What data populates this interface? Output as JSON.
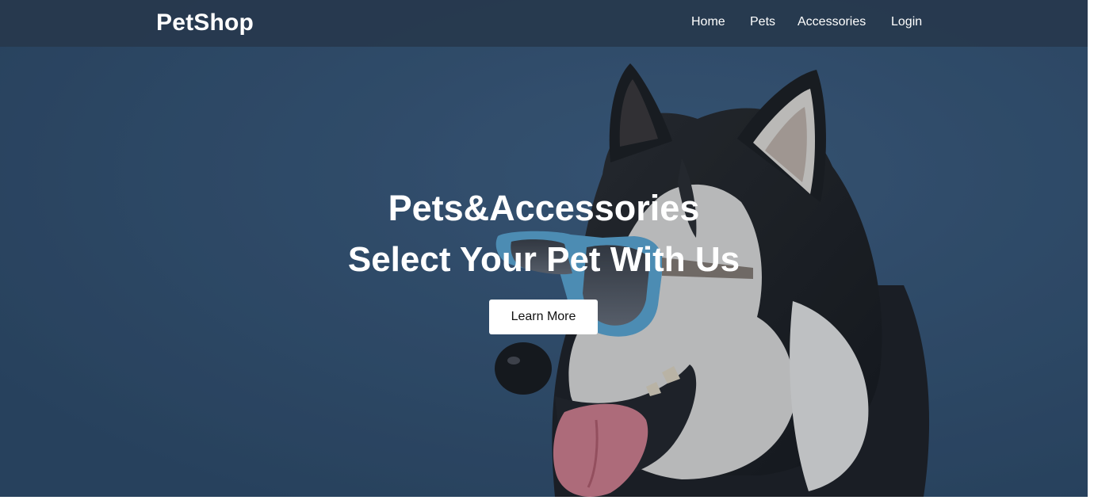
{
  "navbar": {
    "brand": "PetShop",
    "links": [
      "Home",
      "Pets",
      "Accessories",
      "Login"
    ]
  },
  "hero": {
    "title": "Pets&Accessories",
    "subtitle": "Select Your Pet With Us",
    "cta_label": "Learn More",
    "image": "husky-with-sunglasses"
  },
  "colors": {
    "background": "#355272",
    "navbar": "#27384d",
    "text": "#ffffff",
    "button_bg": "#ffffff",
    "button_text": "#111111"
  }
}
